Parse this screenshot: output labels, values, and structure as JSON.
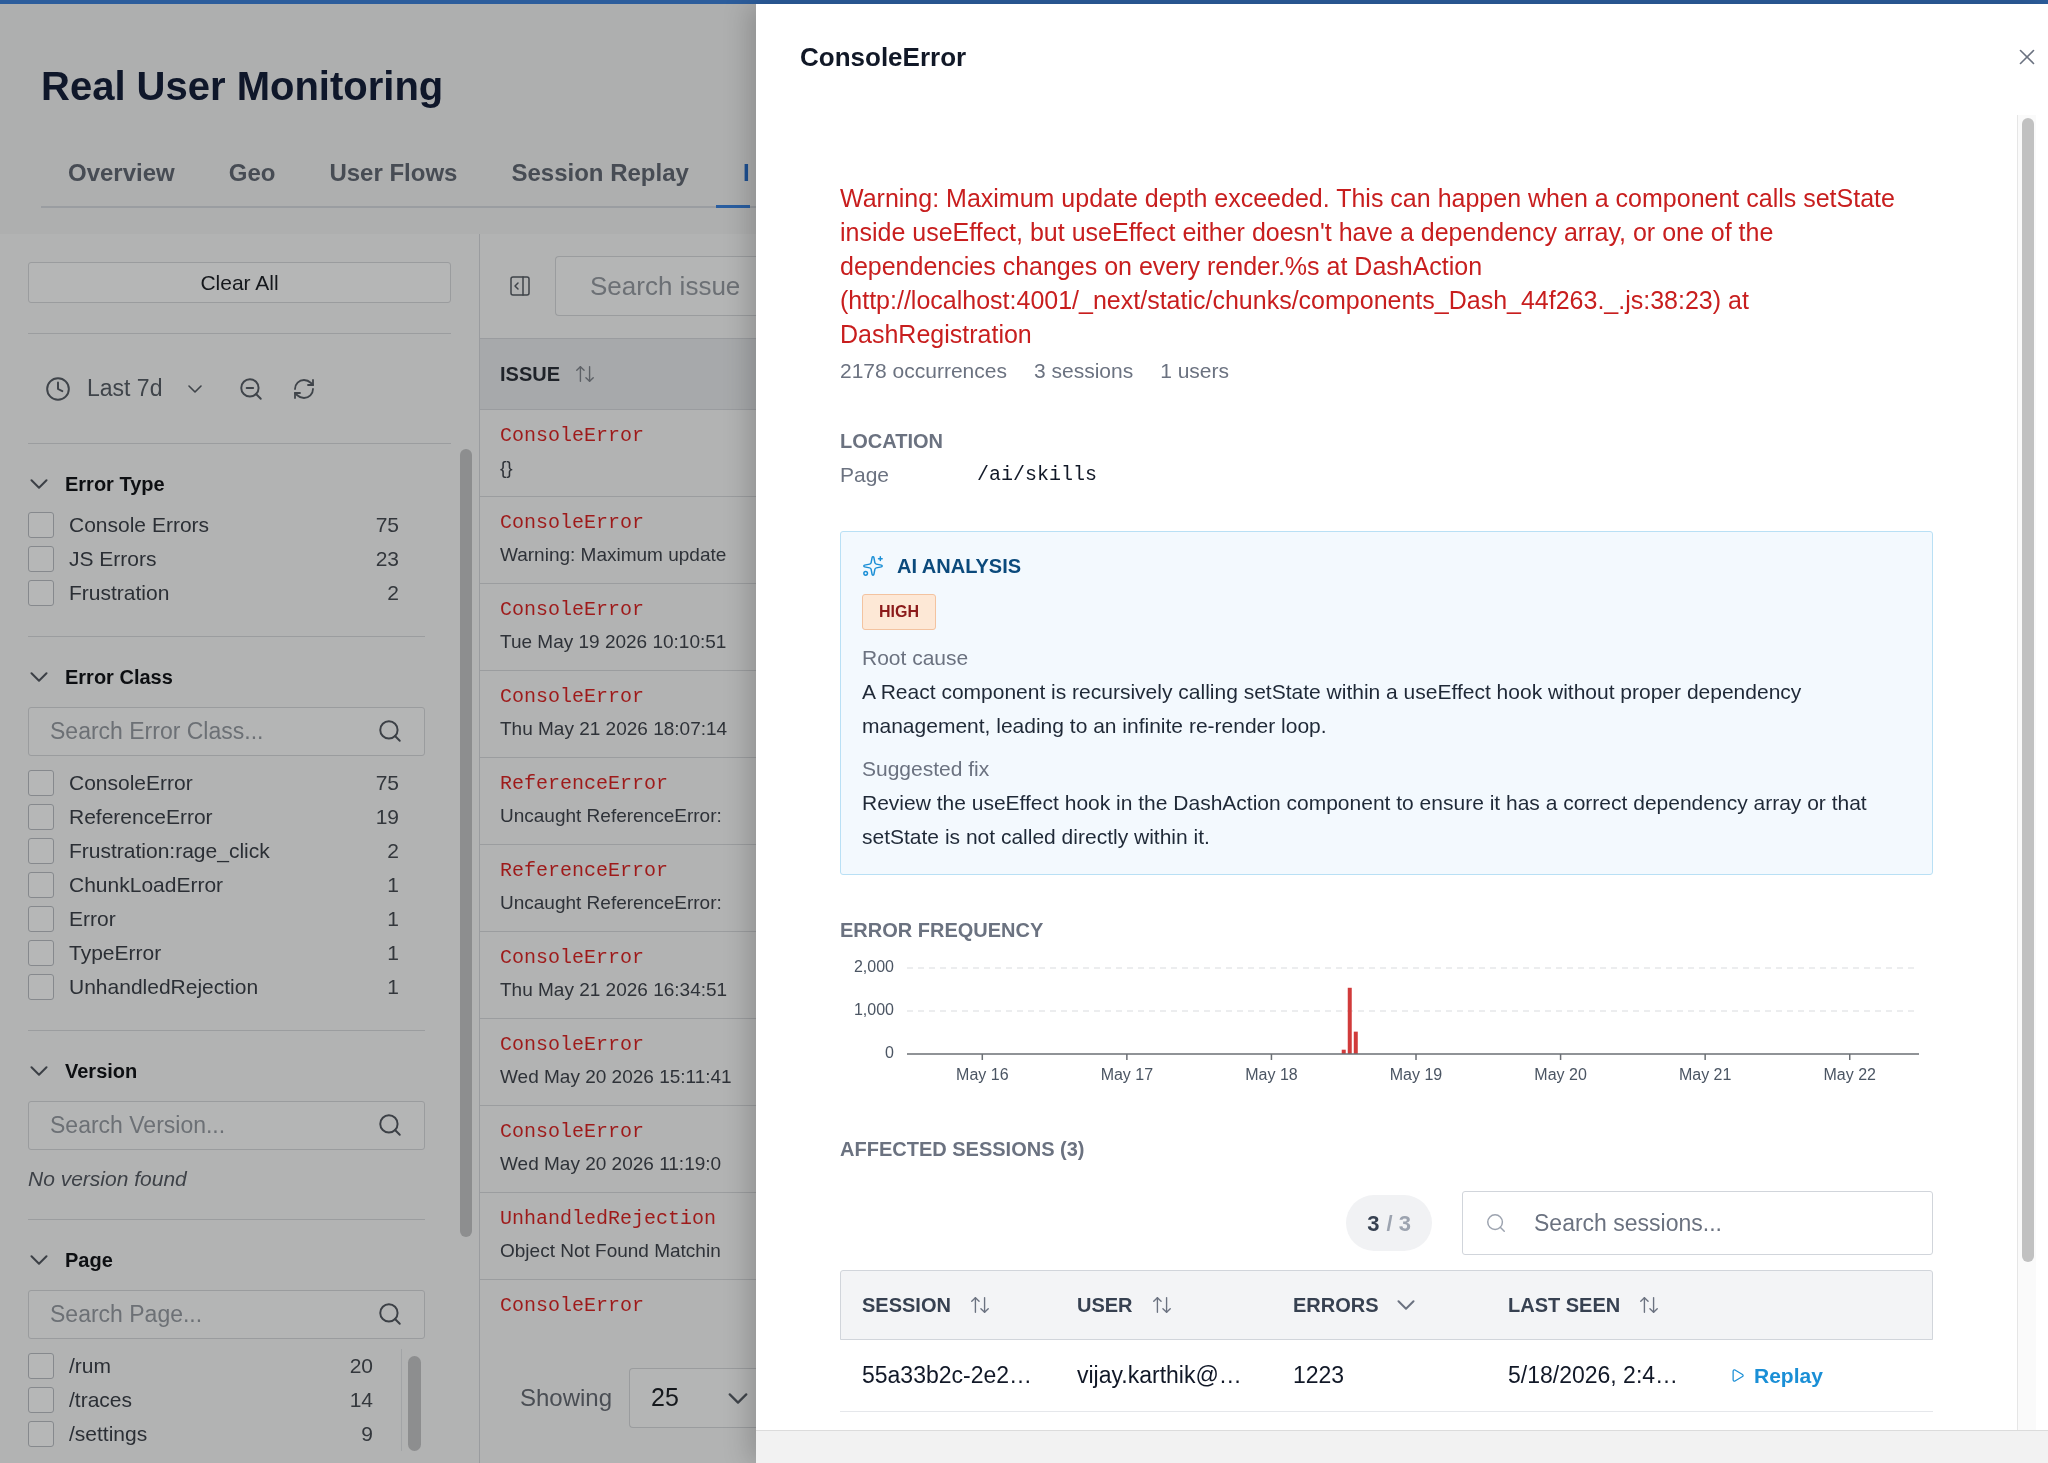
{
  "app": {
    "title": "Real User Monitoring"
  },
  "tabs": [
    {
      "label": "Overview",
      "selected": false
    },
    {
      "label": "Geo",
      "selected": false
    },
    {
      "label": "User Flows",
      "selected": false
    },
    {
      "label": "Session Replay",
      "selected": false
    },
    {
      "label": "I",
      "selected": true
    }
  ],
  "filters": {
    "clear_button": "Clear All",
    "time_range": "Last 7d",
    "sections": [
      {
        "title": "Error Type",
        "expanded": true,
        "items": [
          {
            "label": "Console Errors",
            "count": "75",
            "checked": false
          },
          {
            "label": "JS Errors",
            "count": "23",
            "checked": false
          },
          {
            "label": "Frustration",
            "count": "2",
            "checked": false
          }
        ]
      },
      {
        "title": "Error Class",
        "expanded": true,
        "search": {
          "placeholder": "Search Error Class..."
        },
        "items": [
          {
            "label": "ConsoleError",
            "count": "75",
            "checked": false
          },
          {
            "label": "ReferenceError",
            "count": "19",
            "checked": false
          },
          {
            "label": "Frustration:rage_click",
            "count": "2",
            "checked": false
          },
          {
            "label": "ChunkLoadError",
            "count": "1",
            "checked": false
          },
          {
            "label": "Error",
            "count": "1",
            "checked": false
          },
          {
            "label": "TypeError",
            "count": "1",
            "checked": false
          },
          {
            "label": "UnhandledRejection",
            "count": "1",
            "checked": false
          }
        ]
      },
      {
        "title": "Version",
        "expanded": true,
        "search": {
          "placeholder": "Search Version..."
        },
        "empty_text": "No version found"
      },
      {
        "title": "Page",
        "expanded": true,
        "search": {
          "placeholder": "Search Page..."
        },
        "items": [
          {
            "label": "/rum",
            "count": "20",
            "checked": false
          },
          {
            "label": "/traces",
            "count": "14",
            "checked": false
          },
          {
            "label": "/settings",
            "count": "9",
            "checked": false
          }
        ]
      }
    ]
  },
  "issues": {
    "search": {
      "placeholder": "Search issue"
    },
    "column": {
      "label": "ISSUE",
      "sorted": false
    },
    "rows": [
      {
        "type": "ConsoleError",
        "message": "{}"
      },
      {
        "type": "ConsoleError",
        "message": "Warning: Maximum update"
      },
      {
        "type": "ConsoleError",
        "message": "Tue May 19 2026 10:10:51"
      },
      {
        "type": "ConsoleError",
        "message": "Thu May 21 2026 18:07:14"
      },
      {
        "type": "ReferenceError",
        "message": "Uncaught ReferenceError:"
      },
      {
        "type": "ReferenceError",
        "message": "Uncaught ReferenceError:"
      },
      {
        "type": "ConsoleError",
        "message": "Thu May 21 2026 16:34:51"
      },
      {
        "type": "ConsoleError",
        "message": "Wed May 20 2026 15:11:41"
      },
      {
        "type": "ConsoleError",
        "message": "Wed May 20 2026 11:19:0"
      },
      {
        "type": "UnhandledRejection",
        "message": "Object Not Found Matchin"
      },
      {
        "type": "ConsoleError"
      }
    ],
    "footer": {
      "label": "Showing",
      "page_size": "25"
    }
  },
  "drawer": {
    "title": "ConsoleError",
    "message": "Warning: Maximum update depth exceeded. This can happen when a component calls setState inside useEffect, but useEffect either doesn't have a dependency array, or one of the dependencies changes on every render.%s at DashAction (http://localhost:4001/_next/static/chunks/components_Dash_44f263._.js:38:23) at DashRegistration",
    "stats": [
      "2178 occurrences",
      "3 sessions",
      "1 users"
    ],
    "location": {
      "title": "LOCATION",
      "fields": [
        {
          "label": "Page",
          "value": "/ai/skills"
        }
      ]
    },
    "analysis": {
      "title": "AI ANALYSIS",
      "severity": "HIGH",
      "sections": [
        {
          "label": "Root cause",
          "text": "A React component is recursively calling setState within a useEffect hook without proper dependency management, leading to an infinite re-render loop."
        },
        {
          "label": "Suggested fix",
          "text": "Review the useEffect hook in the DashAction component to ensure it has a correct dependency array or that setState is not called directly within it."
        }
      ]
    },
    "chart_data": {
      "type": "bar",
      "title": "ERROR FREQUENCY",
      "categories": [
        null,
        null,
        null,
        null,
        null,
        null,
        null,
        null,
        null,
        null,
        null,
        null,
        "May 16",
        null,
        null,
        null,
        null,
        null,
        null,
        null,
        null,
        null,
        null,
        null,
        null,
        null,
        null,
        null,
        null,
        null,
        null,
        null,
        null,
        null,
        null,
        null,
        "May 17",
        null,
        null,
        null,
        null,
        null,
        null,
        null,
        null,
        null,
        null,
        null,
        null,
        null,
        null,
        null,
        null,
        null,
        null,
        null,
        null,
        null,
        null,
        null,
        "May 18",
        null,
        null,
        null,
        null,
        null,
        null,
        null,
        null,
        null,
        null,
        null,
        null,
        null,
        null,
        null,
        null,
        null,
        null,
        null,
        null,
        null,
        null,
        null,
        "May 19",
        null,
        null,
        null,
        null,
        null,
        null,
        null,
        null,
        null,
        null,
        null,
        null,
        null,
        null,
        null,
        null,
        null,
        null,
        null,
        null,
        null,
        null,
        null,
        "May 20",
        null,
        null,
        null,
        null,
        null,
        null,
        null,
        null,
        null,
        null,
        null,
        null,
        null,
        null,
        null,
        null,
        null,
        null,
        null,
        null,
        null,
        null,
        null,
        "May 21",
        null,
        null,
        null,
        null,
        null,
        null,
        null,
        null,
        null,
        null,
        null,
        null,
        null,
        null,
        null,
        null,
        null,
        null,
        null,
        null,
        null,
        null,
        null,
        "May 22",
        null,
        null,
        null,
        null,
        null,
        null,
        null,
        null,
        null,
        null,
        null
      ],
      "series": [
        {
          "color": "#d13b3b",
          "values": [
            null,
            null,
            null,
            null,
            null,
            null,
            null,
            null,
            null,
            null,
            null,
            null,
            null,
            null,
            null,
            null,
            null,
            null,
            null,
            null,
            null,
            null,
            null,
            null,
            null,
            null,
            null,
            null,
            null,
            null,
            null,
            null,
            null,
            null,
            null,
            null,
            null,
            null,
            null,
            null,
            null,
            null,
            null,
            null,
            null,
            null,
            null,
            null,
            null,
            null,
            null,
            null,
            null,
            null,
            null,
            null,
            null,
            null,
            null,
            null,
            null,
            null,
            null,
            null,
            null,
            null,
            null,
            null,
            null,
            null,
            null,
            null,
            100,
            1540,
            520,
            null,
            null,
            null,
            null,
            null,
            null,
            null,
            null,
            null,
            null,
            null,
            null,
            null,
            null,
            null,
            null,
            null,
            null,
            null,
            null,
            null,
            null,
            null,
            null,
            null,
            null,
            null,
            null,
            null,
            null,
            null,
            null,
            null,
            null,
            null,
            null,
            null,
            null,
            null,
            null,
            null,
            null,
            null,
            null,
            null,
            null,
            null,
            null,
            null,
            null,
            null,
            null,
            null,
            null,
            null,
            null,
            null,
            null,
            null,
            null,
            null,
            null,
            null,
            null,
            null,
            null,
            null,
            null,
            null,
            null,
            null,
            null,
            null,
            null,
            null,
            null,
            null,
            null,
            null,
            null,
            null,
            null,
            null,
            null,
            null,
            null,
            null,
            null,
            null,
            null,
            null,
            null,
            null
          ]
        }
      ],
      "ylim": [
        0,
        2000
      ],
      "yticks": [
        {
          "value": 0,
          "label": "0"
        },
        {
          "value": 1000,
          "label": "1,000"
        },
        {
          "value": 2000,
          "label": "2,000"
        }
      ]
    },
    "sessions": {
      "title": "AFFECTED SESSIONS (3)",
      "count": {
        "shown": "3",
        "of": "/ 3"
      },
      "search": {
        "placeholder": "Search sessions..."
      },
      "columns": [
        {
          "label": "SESSION",
          "sorted": false
        },
        {
          "label": "USER",
          "sorted": false
        },
        {
          "label": "ERRORS",
          "sorted": true
        },
        {
          "label": "LAST SEEN",
          "sorted": false
        }
      ],
      "rows": [
        {
          "cells": [
            "55a33b2c-2e2…",
            "vijay.karthik@…",
            "1223",
            "5/18/2026, 2:4…"
          ],
          "action": "Replay"
        }
      ]
    }
  }
}
